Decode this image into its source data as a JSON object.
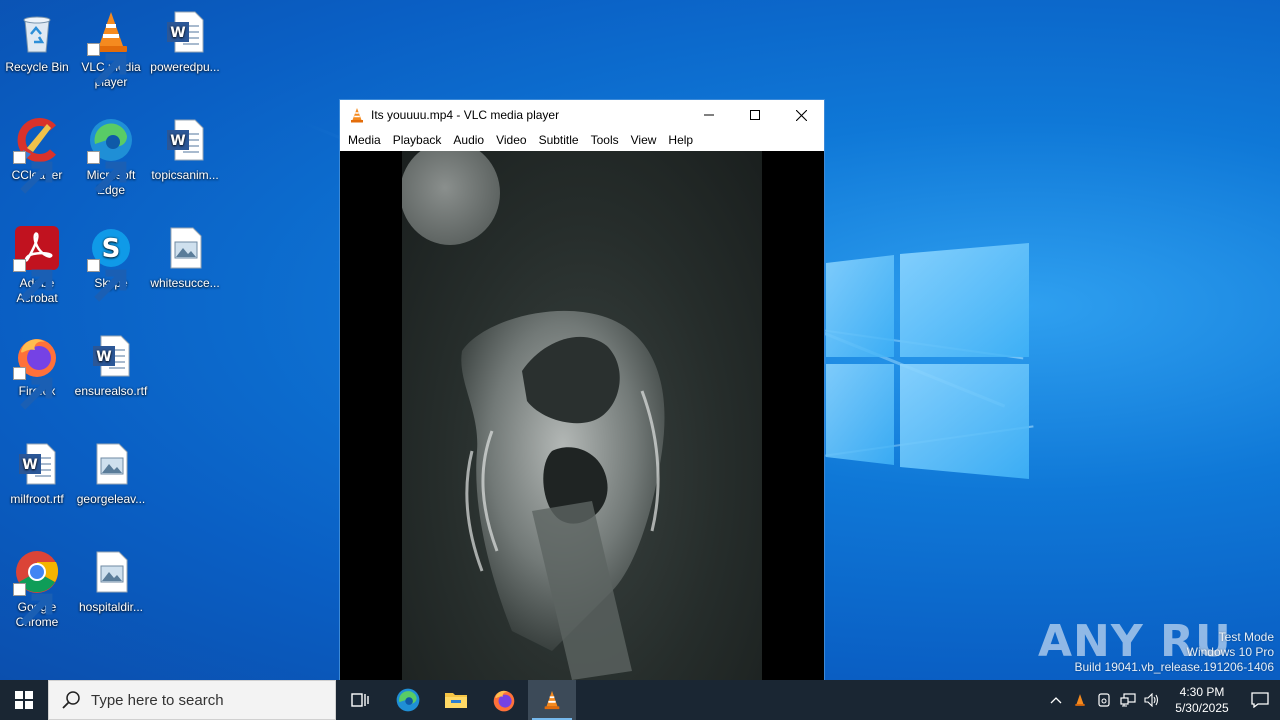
{
  "desktop": {
    "icons": [
      {
        "label": "Recycle Bin",
        "icon": "recycle-bin-icon"
      },
      {
        "label": "VLC media player",
        "icon": "vlc-icon"
      },
      {
        "label": "poweredpu...",
        "icon": "word-doc-icon"
      },
      {
        "label": "CCleaner",
        "icon": "ccleaner-icon"
      },
      {
        "label": "Microsoft Edge",
        "icon": "edge-icon"
      },
      {
        "label": "topicsanim...",
        "icon": "word-doc-icon"
      },
      {
        "label": "Adobe Acrobat",
        "icon": "acrobat-icon"
      },
      {
        "label": "Skype",
        "icon": "skype-icon"
      },
      {
        "label": "whitesucce...",
        "icon": "image-file-icon"
      },
      {
        "label": "Firefox",
        "icon": "firefox-icon"
      },
      {
        "label": "ensurealso.rtf",
        "icon": "word-doc-icon"
      },
      {
        "label": "milfroot.rtf",
        "icon": "word-doc-icon"
      },
      {
        "label": "georgeleav...",
        "icon": "image-file-icon"
      },
      {
        "label": "Google Chrome",
        "icon": "chrome-icon"
      },
      {
        "label": "hospitaldir..."
      }
    ]
  },
  "vlc_window": {
    "title": "Its youuuu.mp4 - VLC media player",
    "menu": [
      "Media",
      "Playback",
      "Audio",
      "Video",
      "Subtitle",
      "Tools",
      "View",
      "Help"
    ]
  },
  "watermark": {
    "brand": "ANY RUN",
    "line1": "Test Mode",
    "line2": "Windows 10 Pro",
    "line3": "Build 19041.vb_release.191206-1406"
  },
  "taskbar": {
    "search_placeholder": "Type here to search",
    "pinned": [
      "task-view-icon",
      "edge-icon",
      "file-explorer-icon",
      "firefox-icon",
      "vlc-icon"
    ],
    "clock_time": "4:30 PM",
    "clock_date": "5/30/2025"
  },
  "colors": {
    "desktop_blue": "#0f78d7",
    "taskbar": "#1a2633",
    "vlc_orange": "#f58a1f"
  }
}
